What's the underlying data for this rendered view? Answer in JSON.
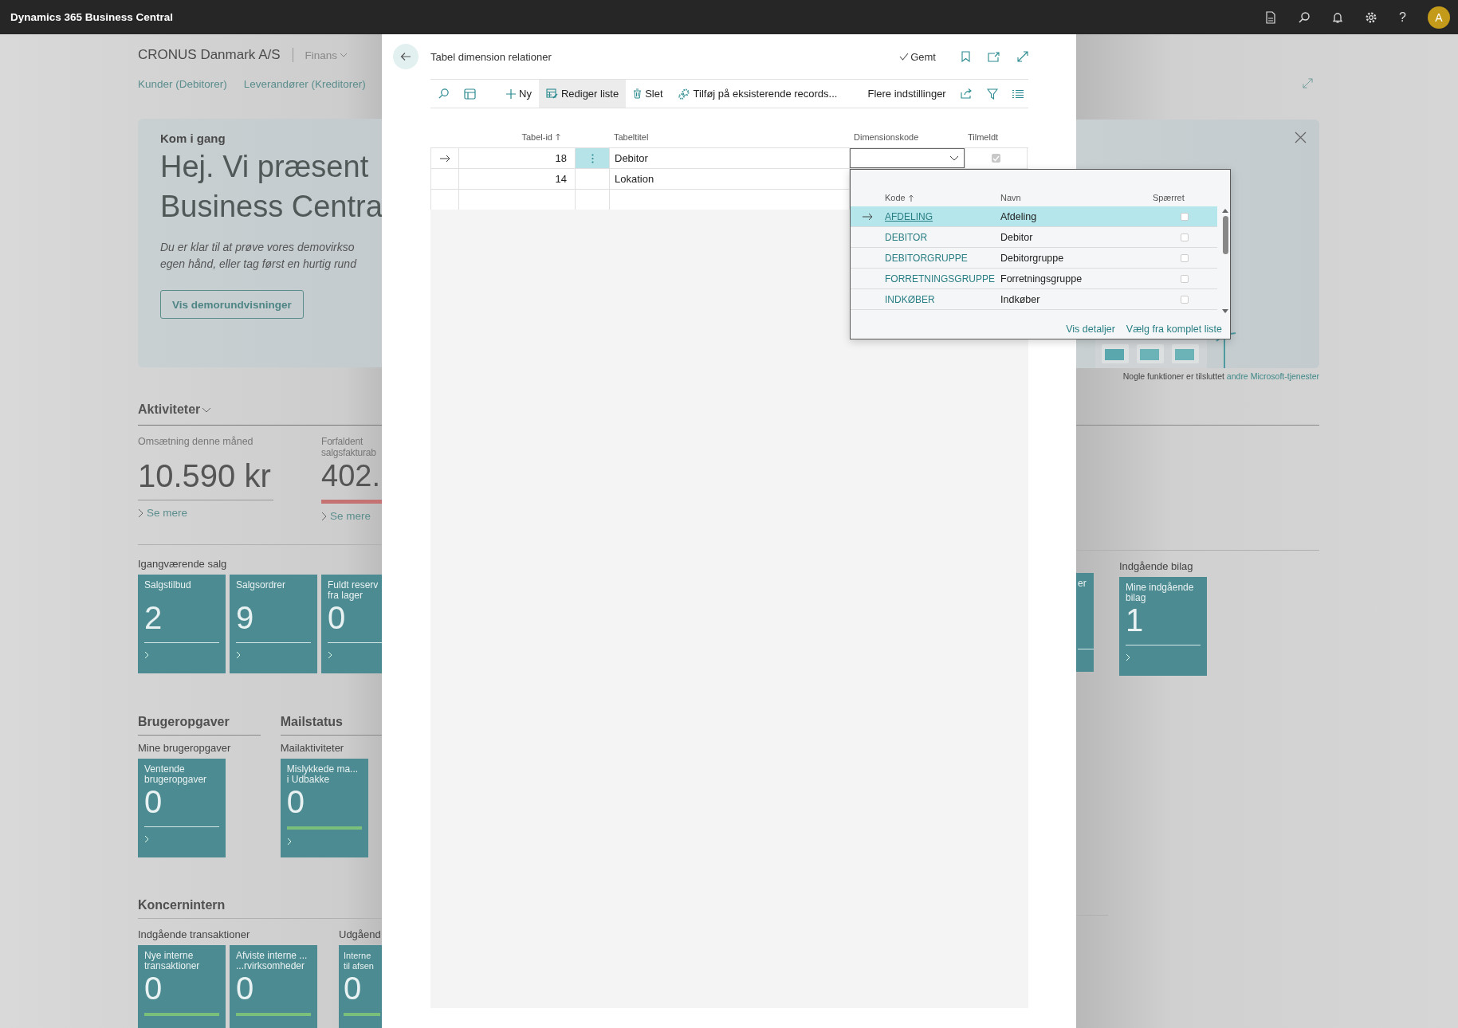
{
  "app_bar": {
    "title": "Dynamics 365 Business Central",
    "help": "?",
    "avatar": "A"
  },
  "background": {
    "company": "CRONUS Danmark A/S",
    "role_menu": "Finans",
    "nav_links": [
      "Kunder (Debitorer)",
      "Leverandører (Kreditorer)"
    ],
    "hero": {
      "eyebrow": "Kom i gang",
      "heading_lines": [
        "Hej. Vi præsent",
        "Business Centra"
      ],
      "text": "Du er klar til at prøve vores demovirkso\negen hånd, eller tag først en hurtig rund",
      "button": "Vis demorundvisninger",
      "footnote": "Nogle funktioner er tilsluttet",
      "footnote_link": "andre Microsoft-tjenester"
    },
    "activities": {
      "title": "Aktiviteter",
      "kpis": [
        {
          "label": "Omsætning denne måned",
          "value": "10.590 kr",
          "link": "Se mere",
          "kind": "neutral"
        },
        {
          "label": "Forfaldent\nsalgsfakturab",
          "value": "402.",
          "link": "Se mere",
          "kind": "alert"
        }
      ]
    },
    "sales": {
      "title": "Igangværende salg",
      "tiles": [
        {
          "title": "Salgstilbud",
          "value": "2",
          "kind": "plain"
        },
        {
          "title": "Salgsordrer",
          "value": "9",
          "kind": "plain"
        },
        {
          "title": "Fuldt reserv\nfra lager",
          "value": "0",
          "kind": "plain"
        }
      ]
    },
    "task_sections": [
      {
        "title": "Brugeropgaver",
        "subtitle": "Mine brugeropgaver",
        "tiles": [
          {
            "title": "Ventende\nbrugeropgaver",
            "value": "0",
            "kind": "plain"
          }
        ]
      },
      {
        "title": "Mailstatus",
        "subtitle": "Mailaktiviteter",
        "tiles": [
          {
            "title": "Mislykkede ma...\ni Udbakke",
            "value": "0",
            "kind": "ok"
          }
        ]
      }
    ],
    "intercompany": {
      "title": "Koncernintern",
      "groups": [
        {
          "subtitle": "Indgående transaktioner",
          "tiles": [
            {
              "title": "Nye interne\ntransaktioner",
              "value": "0",
              "kind": "ok"
            },
            {
              "title": "Afviste interne ...\n...rvirksomheder",
              "value": "0",
              "kind": "ok"
            }
          ]
        },
        {
          "subtitle": "Udgåend",
          "tiles": [
            {
              "title": "Interne\ntil afsen",
              "value": "0",
              "kind": "ok"
            }
          ]
        }
      ]
    },
    "right_tiles": [
      {
        "title": "er",
        "kind": "plain"
      }
    ],
    "incoming": {
      "title": "Indgående bilag",
      "tiles": [
        {
          "title": "Mine indgående\nbilag",
          "value": "1",
          "kind": "plain"
        }
      ]
    }
  },
  "dialog": {
    "title": "Tabel dimension relationer",
    "status": "Gemt",
    "actions": [
      {
        "label": "Ny",
        "selected": false
      },
      {
        "label": "Rediger liste",
        "selected": true
      },
      {
        "label": "Slet",
        "selected": false
      },
      {
        "label": "Tilføj på eksisterende records...",
        "selected": false
      },
      {
        "label": "Flere indstillinger",
        "selected": false
      }
    ],
    "columns": [
      {
        "label": "Tabel-id",
        "sorted": true
      },
      {
        "label": "Tabeltitel",
        "sorted": false
      },
      {
        "label": "Dimensionskode",
        "sorted": false
      },
      {
        "label": "Tilmeldt",
        "sorted": false
      }
    ],
    "rows": [
      {
        "table_id": "18",
        "title": "Debitor",
        "enrolled": true,
        "selected": true
      },
      {
        "table_id": "14",
        "title": "Lokation",
        "selected": false
      },
      {
        "selected": false
      }
    ],
    "lookup": {
      "columns": [
        {
          "label": "Kode",
          "sorted": true
        },
        {
          "label": "Navn",
          "sorted": false
        },
        {
          "label": "Spærret",
          "sorted": false
        }
      ],
      "rows": [
        {
          "code": "AFDELING",
          "name": "Afdeling",
          "blocked": false,
          "selected": true
        },
        {
          "code": "DEBITOR",
          "name": "Debitor",
          "blocked": false,
          "selected": false
        },
        {
          "code": "DEBITORGRUPPE",
          "name": "Debitorgruppe",
          "blocked": false,
          "selected": false
        },
        {
          "code": "FORRETNINGSGRUPPE",
          "name": "Forretningsgruppe",
          "blocked": false,
          "selected": false
        },
        {
          "code": "INDKØBER",
          "name": "Indkøber",
          "blocked": false,
          "selected": false
        }
      ],
      "links": [
        "Vis detaljer",
        "Vælg fra komplet liste"
      ]
    }
  }
}
